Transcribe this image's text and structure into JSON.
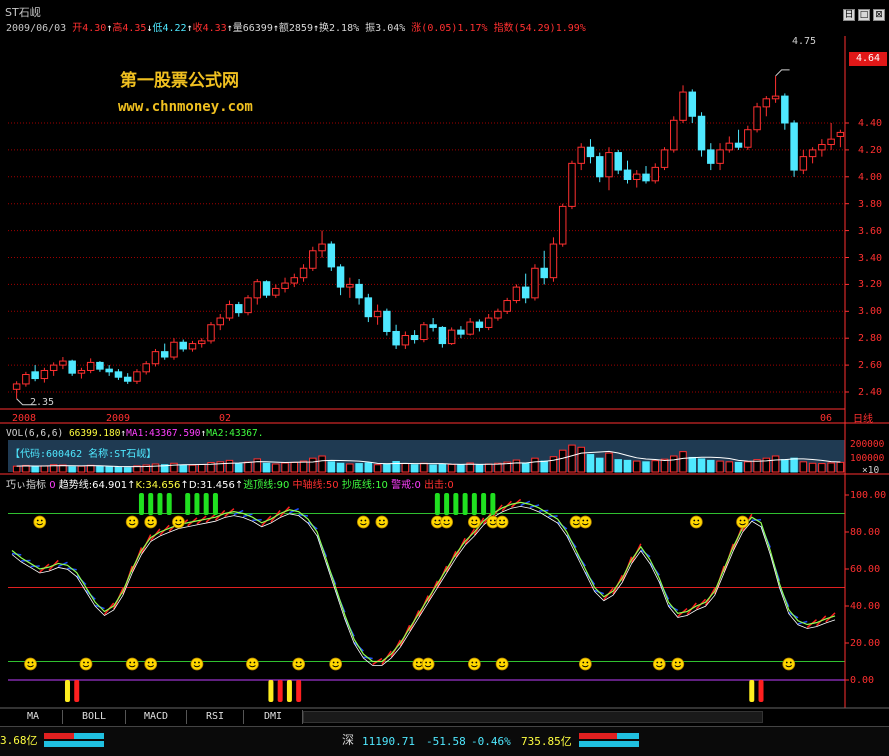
{
  "title": "ST石岘",
  "window_buttons": [
    "日",
    "□",
    "⊠"
  ],
  "quote": {
    "date": "2009/06/03",
    "open_label": "开",
    "open": "4.30",
    "high_label": "高",
    "high": "4.35",
    "low_label": "低",
    "low": "4.22",
    "close_label": "收",
    "close": "4.33",
    "vol_label": "量",
    "vol": "66399",
    "amt_label": "额",
    "amt": "2859",
    "turn_label": "换",
    "turn": "2.18%",
    "amp_label": "振",
    "amp": "3.04%",
    "chg_label": "涨",
    "chg": "(0.05)",
    "chg_pct": "1.17%",
    "idx_label": "指数",
    "idx": "(54.29)",
    "idx_pct": "1.99%"
  },
  "watermark": {
    "line1": "第一股票公式网",
    "line2": "www.chnmoney.com"
  },
  "price_axis": [
    "4.40",
    "4.20",
    "4.00",
    "3.80",
    "3.60",
    "3.40",
    "3.20",
    "3.00",
    "2.80",
    "2.60",
    "2.40"
  ],
  "current_price_tag": "4.64",
  "max_label": "4.75",
  "min_label": "2.35",
  "date_labels": [
    "2008",
    "2009",
    "02",
    "06"
  ],
  "period_label": "日线",
  "vol_header": {
    "name": "VOL(6,6,6)",
    "vol": "66399.180",
    "ma1": "MA1:43367.590",
    "ma2": "MA2:43367."
  },
  "vol_info": "【代码:600462 名称:ST石岘】",
  "vol_axis": [
    "200000",
    "100000",
    "×10"
  ],
  "indicator": {
    "name": "巧ぃ指标",
    "zero": "0",
    "trend": "趋势线:64.901",
    "k": "K:34.656",
    "d": "D:31.456",
    "escape": "逃顶线:90",
    "mid": "中轴线:50",
    "bottom": "抄底线:10",
    "warn": "警戒:0",
    "out": "出击:0"
  },
  "ind_axis": [
    "100.00",
    "80.00",
    "60.00",
    "40.00",
    "20.00",
    "0.00"
  ],
  "tabs": [
    "MA",
    "BOLL",
    "MACD",
    "RSI",
    "DMI"
  ],
  "status": {
    "left_value": "3.68亿",
    "market": "深",
    "index": "11190.71",
    "change": "-51.58",
    "pct": "-0.46%",
    "amount": "735.85亿"
  },
  "colors": {
    "up": "#ff3030",
    "down": "#4fe8ff",
    "grid": "#a00000",
    "ma": "#ffffff",
    "trend_k": "#90ff50",
    "axis": "#ff3030"
  },
  "chart_data": [
    {
      "type": "candlestick",
      "title": "ST石岘",
      "ylim": [
        2.3,
        4.8
      ],
      "candles": [
        {
          "o": 2.42,
          "h": 2.48,
          "l": 2.35,
          "c": 2.46
        },
        {
          "o": 2.46,
          "h": 2.55,
          "l": 2.44,
          "c": 2.53
        },
        {
          "o": 2.55,
          "h": 2.6,
          "l": 2.48,
          "c": 2.5
        },
        {
          "o": 2.5,
          "h": 2.58,
          "l": 2.47,
          "c": 2.56
        },
        {
          "o": 2.56,
          "h": 2.62,
          "l": 2.52,
          "c": 2.6
        },
        {
          "o": 2.6,
          "h": 2.66,
          "l": 2.57,
          "c": 2.63
        },
        {
          "o": 2.63,
          "h": 2.64,
          "l": 2.52,
          "c": 2.54
        },
        {
          "o": 2.54,
          "h": 2.58,
          "l": 2.5,
          "c": 2.56
        },
        {
          "o": 2.56,
          "h": 2.65,
          "l": 2.54,
          "c": 2.62
        },
        {
          "o": 2.62,
          "h": 2.63,
          "l": 2.55,
          "c": 2.57
        },
        {
          "o": 2.57,
          "h": 2.6,
          "l": 2.52,
          "c": 2.55
        },
        {
          "o": 2.55,
          "h": 2.57,
          "l": 2.49,
          "c": 2.51
        },
        {
          "o": 2.51,
          "h": 2.54,
          "l": 2.46,
          "c": 2.48
        },
        {
          "o": 2.48,
          "h": 2.57,
          "l": 2.46,
          "c": 2.55
        },
        {
          "o": 2.55,
          "h": 2.63,
          "l": 2.53,
          "c": 2.61
        },
        {
          "o": 2.61,
          "h": 2.72,
          "l": 2.59,
          "c": 2.7
        },
        {
          "o": 2.7,
          "h": 2.76,
          "l": 2.64,
          "c": 2.66
        },
        {
          "o": 2.66,
          "h": 2.8,
          "l": 2.64,
          "c": 2.77
        },
        {
          "o": 2.77,
          "h": 2.79,
          "l": 2.7,
          "c": 2.72
        },
        {
          "o": 2.72,
          "h": 2.78,
          "l": 2.7,
          "c": 2.76
        },
        {
          "o": 2.76,
          "h": 2.8,
          "l": 2.73,
          "c": 2.78
        },
        {
          "o": 2.78,
          "h": 2.92,
          "l": 2.76,
          "c": 2.9
        },
        {
          "o": 2.9,
          "h": 2.98,
          "l": 2.86,
          "c": 2.95
        },
        {
          "o": 2.95,
          "h": 3.08,
          "l": 2.93,
          "c": 3.05
        },
        {
          "o": 3.05,
          "h": 3.07,
          "l": 2.96,
          "c": 2.99
        },
        {
          "o": 2.99,
          "h": 3.12,
          "l": 2.97,
          "c": 3.1
        },
        {
          "o": 3.1,
          "h": 3.24,
          "l": 3.05,
          "c": 3.22
        },
        {
          "o": 3.22,
          "h": 3.23,
          "l": 3.1,
          "c": 3.12
        },
        {
          "o": 3.12,
          "h": 3.2,
          "l": 3.1,
          "c": 3.17
        },
        {
          "o": 3.17,
          "h": 3.25,
          "l": 3.14,
          "c": 3.21
        },
        {
          "o": 3.21,
          "h": 3.28,
          "l": 3.18,
          "c": 3.25
        },
        {
          "o": 3.25,
          "h": 3.35,
          "l": 3.22,
          "c": 3.32
        },
        {
          "o": 3.32,
          "h": 3.48,
          "l": 3.3,
          "c": 3.45
        },
        {
          "o": 3.45,
          "h": 3.6,
          "l": 3.4,
          "c": 3.5
        },
        {
          "o": 3.5,
          "h": 3.52,
          "l": 3.3,
          "c": 3.33
        },
        {
          "o": 3.33,
          "h": 3.35,
          "l": 3.12,
          "c": 3.18
        },
        {
          "o": 3.18,
          "h": 3.25,
          "l": 3.1,
          "c": 3.2
        },
        {
          "o": 3.2,
          "h": 3.24,
          "l": 3.05,
          "c": 3.1
        },
        {
          "o": 3.1,
          "h": 3.13,
          "l": 2.92,
          "c": 2.96
        },
        {
          "o": 2.96,
          "h": 3.05,
          "l": 2.9,
          "c": 3.0
        },
        {
          "o": 3.0,
          "h": 3.02,
          "l": 2.82,
          "c": 2.85
        },
        {
          "o": 2.85,
          "h": 2.9,
          "l": 2.72,
          "c": 2.75
        },
        {
          "o": 2.75,
          "h": 2.85,
          "l": 2.72,
          "c": 2.82
        },
        {
          "o": 2.82,
          "h": 2.86,
          "l": 2.76,
          "c": 2.79
        },
        {
          "o": 2.79,
          "h": 2.92,
          "l": 2.77,
          "c": 2.9
        },
        {
          "o": 2.9,
          "h": 2.95,
          "l": 2.85,
          "c": 2.88
        },
        {
          "o": 2.88,
          "h": 2.89,
          "l": 2.73,
          "c": 2.76
        },
        {
          "o": 2.76,
          "h": 2.88,
          "l": 2.75,
          "c": 2.86
        },
        {
          "o": 2.86,
          "h": 2.89,
          "l": 2.8,
          "c": 2.83
        },
        {
          "o": 2.83,
          "h": 2.95,
          "l": 2.82,
          "c": 2.92
        },
        {
          "o": 2.92,
          "h": 2.94,
          "l": 2.85,
          "c": 2.88
        },
        {
          "o": 2.88,
          "h": 2.98,
          "l": 2.86,
          "c": 2.95
        },
        {
          "o": 2.95,
          "h": 3.02,
          "l": 2.93,
          "c": 3.0
        },
        {
          "o": 3.0,
          "h": 3.1,
          "l": 2.98,
          "c": 3.08
        },
        {
          "o": 3.08,
          "h": 3.2,
          "l": 3.06,
          "c": 3.18
        },
        {
          "o": 3.18,
          "h": 3.28,
          "l": 3.06,
          "c": 3.1
        },
        {
          "o": 3.1,
          "h": 3.35,
          "l": 3.08,
          "c": 3.32
        },
        {
          "o": 3.32,
          "h": 3.45,
          "l": 3.2,
          "c": 3.25
        },
        {
          "o": 3.25,
          "h": 3.55,
          "l": 3.22,
          "c": 3.5
        },
        {
          "o": 3.5,
          "h": 3.8,
          "l": 3.48,
          "c": 3.78
        },
        {
          "o": 3.78,
          "h": 4.12,
          "l": 3.76,
          "c": 4.1
        },
        {
          "o": 4.1,
          "h": 4.25,
          "l": 4.05,
          "c": 4.22
        },
        {
          "o": 4.22,
          "h": 4.28,
          "l": 4.1,
          "c": 4.15
        },
        {
          "o": 4.15,
          "h": 4.18,
          "l": 3.96,
          "c": 4.0
        },
        {
          "o": 4.0,
          "h": 4.22,
          "l": 3.9,
          "c": 4.18
        },
        {
          "o": 4.18,
          "h": 4.2,
          "l": 4.02,
          "c": 4.05
        },
        {
          "o": 4.05,
          "h": 4.12,
          "l": 3.95,
          "c": 3.98
        },
        {
          "o": 3.98,
          "h": 4.05,
          "l": 3.92,
          "c": 4.02
        },
        {
          "o": 4.02,
          "h": 4.08,
          "l": 3.95,
          "c": 3.97
        },
        {
          "o": 3.97,
          "h": 4.1,
          "l": 3.95,
          "c": 4.07
        },
        {
          "o": 4.07,
          "h": 4.22,
          "l": 4.05,
          "c": 4.2
        },
        {
          "o": 4.2,
          "h": 4.45,
          "l": 4.18,
          "c": 4.42
        },
        {
          "o": 4.42,
          "h": 4.68,
          "l": 4.4,
          "c": 4.63
        },
        {
          "o": 4.63,
          "h": 4.65,
          "l": 4.4,
          "c": 4.45
        },
        {
          "o": 4.45,
          "h": 4.48,
          "l": 4.15,
          "c": 4.2
        },
        {
          "o": 4.2,
          "h": 4.25,
          "l": 4.05,
          "c": 4.1
        },
        {
          "o": 4.1,
          "h": 4.25,
          "l": 4.05,
          "c": 4.2
        },
        {
          "o": 4.2,
          "h": 4.3,
          "l": 4.18,
          "c": 4.25
        },
        {
          "o": 4.25,
          "h": 4.35,
          "l": 4.2,
          "c": 4.22
        },
        {
          "o": 4.22,
          "h": 4.38,
          "l": 4.2,
          "c": 4.35
        },
        {
          "o": 4.35,
          "h": 4.55,
          "l": 4.33,
          "c": 4.52
        },
        {
          "o": 4.52,
          "h": 4.6,
          "l": 4.45,
          "c": 4.58
        },
        {
          "o": 4.58,
          "h": 4.75,
          "l": 4.55,
          "c": 4.6
        },
        {
          "o": 4.6,
          "h": 4.62,
          "l": 4.35,
          "c": 4.4
        },
        {
          "o": 4.4,
          "h": 4.42,
          "l": 4.0,
          "c": 4.05
        },
        {
          "o": 4.05,
          "h": 4.2,
          "l": 4.02,
          "c": 4.15
        },
        {
          "o": 4.15,
          "h": 4.22,
          "l": 4.1,
          "c": 4.2
        },
        {
          "o": 4.2,
          "h": 4.28,
          "l": 4.15,
          "c": 4.24
        },
        {
          "o": 4.24,
          "h": 4.4,
          "l": 4.2,
          "c": 4.28
        },
        {
          "o": 4.3,
          "h": 4.35,
          "l": 4.22,
          "c": 4.33
        }
      ]
    },
    {
      "type": "bar",
      "title": "VOL(6,6,6)",
      "ylim": [
        0,
        220000
      ],
      "values": [
        40000,
        45000,
        38000,
        42000,
        50000,
        48000,
        36000,
        40000,
        46000,
        38000,
        35000,
        33000,
        30000,
        42000,
        48000,
        55000,
        50000,
        60000,
        45000,
        47000,
        52000,
        65000,
        70000,
        80000,
        55000,
        68000,
        90000,
        60000,
        55000,
        62000,
        66000,
        75000,
        95000,
        110000,
        70000,
        60000,
        55000,
        58000,
        62000,
        50000,
        56000,
        72000,
        58000,
        50000,
        60000,
        48000,
        55000,
        52000,
        50000,
        62000,
        48000,
        55000,
        60000,
        68000,
        82000,
        60000,
        95000,
        75000,
        105000,
        150000,
        185000,
        170000,
        120000,
        95000,
        130000,
        85000,
        80000,
        75000,
        70000,
        78000,
        88000,
        110000,
        140000,
        100000,
        90000,
        80000,
        75000,
        70000,
        66000,
        70000,
        85000,
        95000,
        110000,
        85000,
        95000,
        70000,
        60000,
        58000,
        62000,
        66399
      ]
    },
    {
      "type": "line",
      "title": "巧ぃ指标",
      "ylim": [
        -5,
        105
      ],
      "levels": {
        "escape": 90,
        "mid": 50,
        "bottom": 10,
        "warn": 0
      },
      "series": [
        {
          "name": "趋势线",
          "values": [
            70,
            66,
            63,
            60,
            61,
            63,
            62,
            58,
            50,
            42,
            37,
            40,
            48,
            60,
            70,
            77,
            80,
            82,
            84,
            85,
            86,
            87,
            88,
            90,
            91,
            90,
            88,
            85,
            87,
            90,
            92,
            91,
            87,
            80,
            65,
            50,
            35,
            22,
            14,
            10,
            10,
            14,
            20,
            28,
            36,
            44,
            52,
            60,
            68,
            75,
            80,
            86,
            90,
            93,
            95,
            96,
            95,
            93,
            90,
            87,
            80,
            70,
            60,
            50,
            45,
            48,
            55,
            65,
            72,
            65,
            55,
            42,
            36,
            37,
            40,
            42,
            48,
            60,
            72,
            82,
            88,
            85,
            70,
            52,
            38,
            32,
            30,
            31,
            33,
            34.656
          ]
        }
      ],
      "signals_top": [
        3,
        13,
        15,
        18,
        38,
        40,
        46,
        47,
        50,
        52,
        53,
        61,
        62,
        74,
        79
      ],
      "signals_bottom": [
        2,
        8,
        13,
        15,
        20,
        26,
        31,
        35,
        44,
        45,
        50,
        53,
        62,
        70,
        72,
        84
      ],
      "escape_bars": [
        14,
        15,
        16,
        17,
        19,
        20,
        21,
        22,
        46,
        47,
        48,
        49,
        50,
        51,
        52
      ],
      "warn_bars": [
        6,
        7,
        28,
        29,
        30,
        31,
        80,
        81
      ]
    }
  ]
}
